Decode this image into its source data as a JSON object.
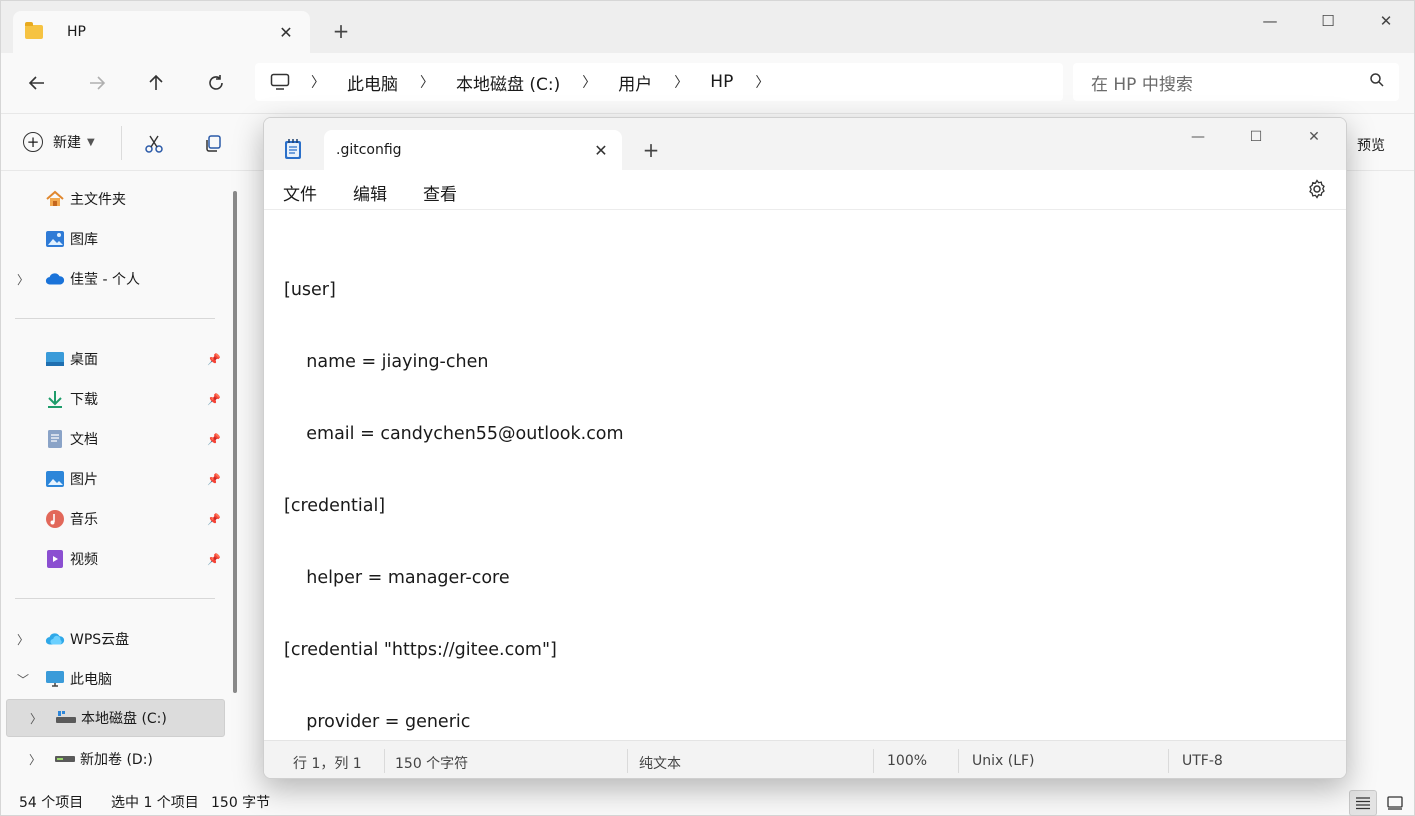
{
  "explorer": {
    "tab_title": "HP",
    "window_controls": [
      "minimize",
      "maximize",
      "close"
    ],
    "nav": {
      "back": "back",
      "forward": "forward",
      "up": "up",
      "refresh": "refresh"
    },
    "breadcrumb": [
      "此电脑",
      "本地磁盘 (C:)",
      "用户",
      "HP"
    ],
    "search_placeholder": "在 HP 中搜索",
    "toolbar": {
      "new_label": "新建",
      "preview_label": "预览"
    },
    "sidebar": {
      "quick": [
        {
          "label": "主文件夹",
          "icon": "home-icon"
        },
        {
          "label": "图库",
          "icon": "gallery-icon"
        },
        {
          "label": "佳莹 - 个人",
          "icon": "onedrive-icon"
        }
      ],
      "pinned": [
        {
          "label": "桌面",
          "icon": "desktop-icon"
        },
        {
          "label": "下载",
          "icon": "download-icon"
        },
        {
          "label": "文档",
          "icon": "documents-icon"
        },
        {
          "label": "图片",
          "icon": "pictures-icon"
        },
        {
          "label": "音乐",
          "icon": "music-icon"
        },
        {
          "label": "视频",
          "icon": "videos-icon"
        }
      ],
      "drives": [
        {
          "label": "WPS云盘",
          "icon": "wps-cloud-icon"
        },
        {
          "label": "此电脑",
          "icon": "this-pc-icon"
        },
        {
          "label": "本地磁盘 (C:)",
          "icon": "drive-icon"
        },
        {
          "label": "新加卷 (D:)",
          "icon": "drive-icon"
        }
      ]
    },
    "status": {
      "item_count": "54 个项目",
      "selected": "选中 1 个项目",
      "size": "150 字节"
    }
  },
  "notepad": {
    "tab_title": ".gitconfig",
    "menu": {
      "file": "文件",
      "edit": "编辑",
      "view": "查看"
    },
    "content_lines": [
      "[user]",
      "\tname = jiaying-chen",
      "\temail = candychen55@outlook.com",
      "[credential]",
      "\thelper = manager-core",
      "[credential \"https://gitee.com\"]",
      "\tprovider = generic"
    ],
    "status": {
      "position": "行 1，列 1",
      "chars": "150 个字符",
      "format": "纯文本",
      "zoom": "100%",
      "line_ending": "Unix (LF)",
      "encoding": "UTF-8"
    }
  }
}
